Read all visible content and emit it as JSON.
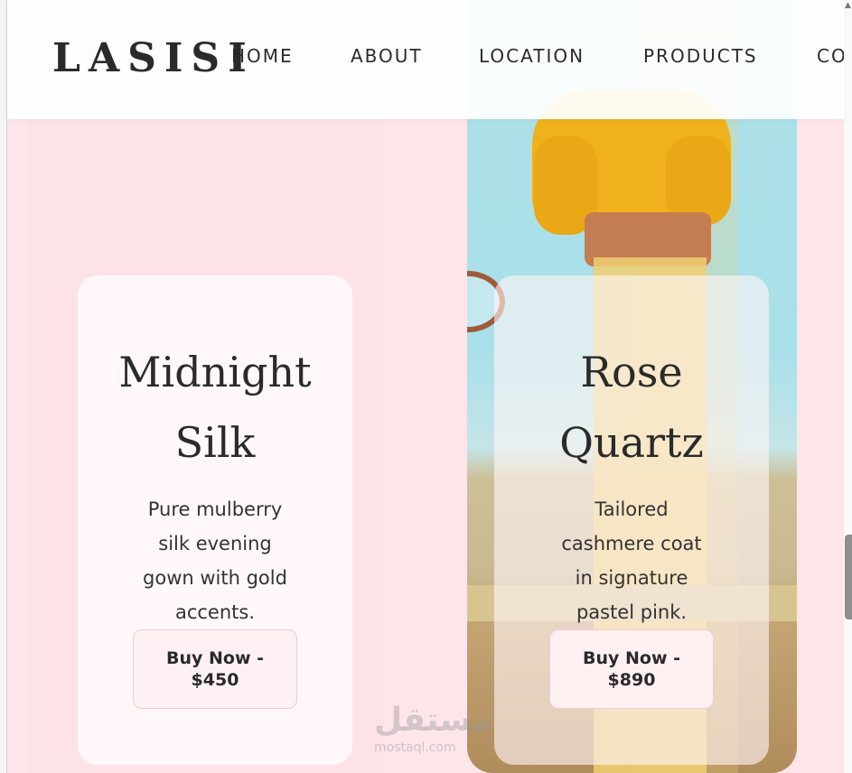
{
  "header": {
    "logo": "LASISI",
    "nav": [
      "HOME",
      "ABOUT",
      "LOCATION",
      "PRODUCTS",
      "CO"
    ]
  },
  "products": [
    {
      "title_line1": "Midnight",
      "title_line2": "Silk",
      "desc_lines": [
        "Pure mulberry",
        "silk evening",
        "gown with gold",
        "accents."
      ],
      "button_line1": "Buy Now -",
      "button_line2": "$450"
    },
    {
      "title_line1": "Rose",
      "title_line2": "Quartz",
      "desc_lines": [
        "Tailored",
        "cashmere coat",
        "in signature",
        "pastel pink."
      ],
      "button_line1": "Buy Now -",
      "button_line2": "$890"
    }
  ],
  "watermark": {
    "arabic": "مستقل",
    "latin": "mostaql.com"
  },
  "colors": {
    "page_bg": "#fde5ea",
    "accent_button_border": "#f4c8d2"
  },
  "icons": {
    "scroll_up": "chevron-up-icon"
  }
}
